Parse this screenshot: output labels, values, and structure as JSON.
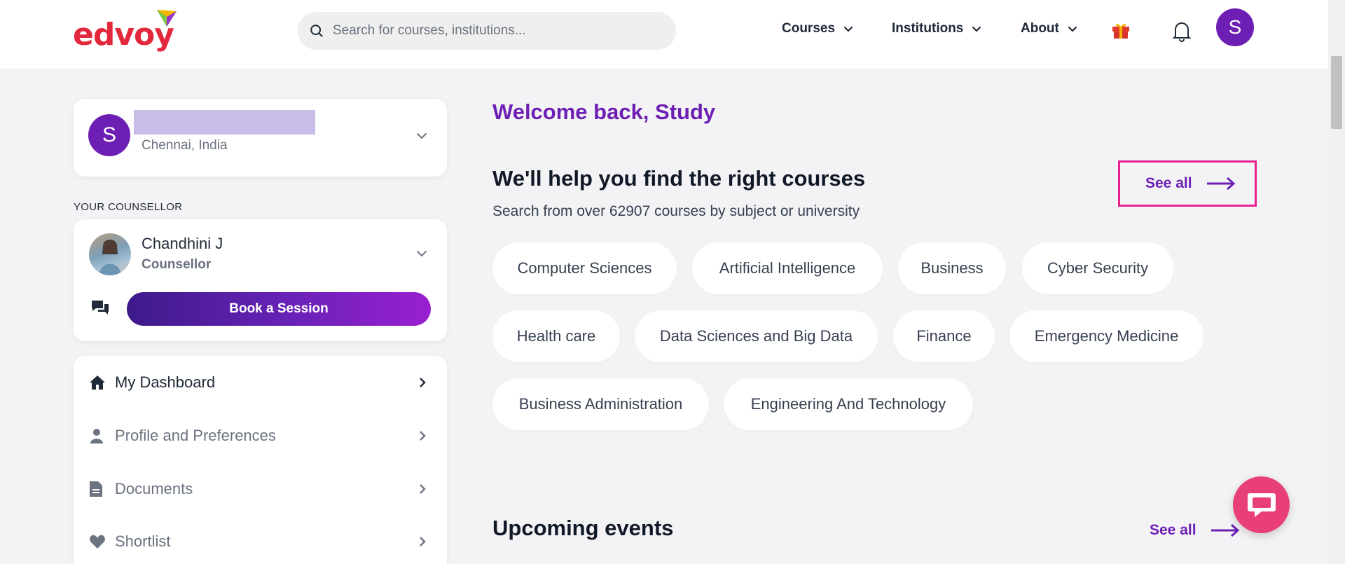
{
  "header": {
    "logo_text": "edvoy",
    "search_placeholder": "Search for courses, institutions...",
    "nav": [
      {
        "label": "Courses"
      },
      {
        "label": "Institutions"
      },
      {
        "label": "About"
      }
    ],
    "avatar_initial": "S",
    "brand_color": "#e4283b",
    "accent_color": "#6d1fb4"
  },
  "sidebar": {
    "profile": {
      "avatar_initial": "S",
      "location": "Chennai, India"
    },
    "counsellor_heading": "YOUR COUNSELLOR",
    "counsellor": {
      "name": "Chandhini J",
      "role": "Counsellor",
      "book_label": "Book a Session"
    },
    "menu": [
      {
        "label": "My Dashboard",
        "icon": "home-icon"
      },
      {
        "label": "Profile and Preferences",
        "icon": "person-icon"
      },
      {
        "label": "Documents",
        "icon": "document-icon"
      },
      {
        "label": "Shortlist",
        "icon": "heart-icon"
      }
    ]
  },
  "main": {
    "welcome": "Welcome back, Study",
    "courses_title": "We'll help you find the right courses",
    "courses_subtitle": "Search from over 62907 courses by subject or university",
    "see_all": "See all",
    "chips": [
      "Computer Sciences",
      "Artificial Intelligence",
      "Business",
      "Cyber Security",
      "Health care",
      "Data Sciences and Big Data",
      "Finance",
      "Emergency Medicine",
      "Business Administration",
      "Engineering And Technology"
    ],
    "events_title": "Upcoming events",
    "events_see_all": "See all"
  }
}
